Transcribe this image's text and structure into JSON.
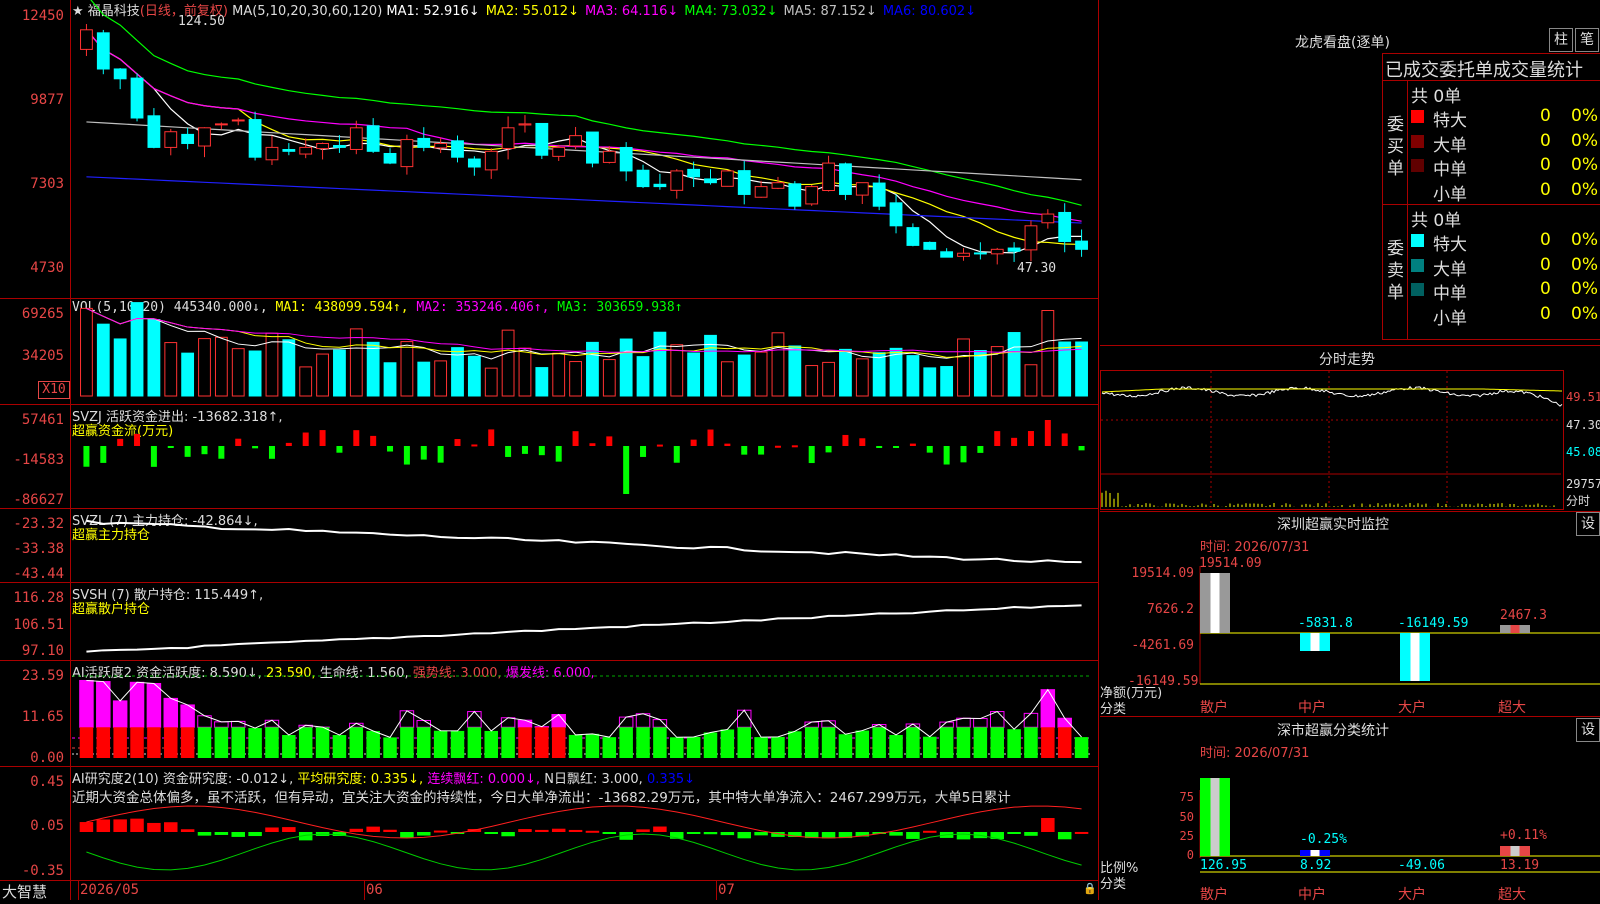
{
  "stock": {
    "name": "福晶科技",
    "period": "(日线，前复权)"
  },
  "ma_line": {
    "label": "MA(5,10,20,30,60,120)",
    "items": [
      {
        "name": "MA1",
        "value": "52.916",
        "arrow": "↓",
        "color": "#ffffff"
      },
      {
        "name": "MA2",
        "value": "55.012",
        "arrow": "↓",
        "color": "#ffff00"
      },
      {
        "name": "MA3",
        "value": "64.116",
        "arrow": "↓",
        "color": "#ff00ff"
      },
      {
        "name": "MA4",
        "value": "73.032",
        "arrow": "↓",
        "color": "#00ff00"
      },
      {
        "name": "MA5",
        "value": "87.152",
        "arrow": "↓",
        "color": "#c0c0c0"
      },
      {
        "name": "MA6",
        "value": "80.602",
        "arrow": "↓",
        "color": "#0000ff"
      }
    ]
  },
  "price_axis": [
    "12450",
    "9877",
    "7303",
    "4730"
  ],
  "price_marks": {
    "high": "124.50",
    "low": "47.30"
  },
  "vol": {
    "label": "VOL(5,10,20)",
    "value": "445340.000↓,",
    "ma1": "MA1: 438099.594↑,",
    "ma2": "MA2: 353246.406↑,",
    "ma3": "MA3: 303659.938↑",
    "axis": [
      "69265",
      "34205"
    ],
    "unit": "X10"
  },
  "svzj": {
    "label": "SVZJ  活跃资金进出: -13682.318↑,",
    "sub": "超赢资金流(万元)",
    "axis": [
      "57461",
      "-14583",
      "-86627"
    ]
  },
  "svzl": {
    "label": "SVZL (7) 主力持仓: -42.864↓,",
    "sub": "超赢主力持仓",
    "axis": [
      "-23.32",
      "-33.38",
      "-43.44"
    ]
  },
  "svsh": {
    "label": "SVSH (7) 散户持仓: 115.449↑,",
    "sub": "超赢散户持仓",
    "axis": [
      "116.28",
      "106.51",
      "97.10"
    ]
  },
  "ai1": {
    "label": "AI活跃度2 资金活跃度: 8.590↓,",
    "v2": "23.590,",
    "v3": "生命线: 1.560,",
    "v4": "强势线: 3.000,",
    "v5": "爆发线: 6.000,",
    "axis": [
      "23.59",
      "11.65",
      "0.00"
    ]
  },
  "ai2": {
    "label": "AI研究度2(10) 资金研究度: -0.012↓,",
    "v2": "平均研究度: 0.335↓,",
    "v3": "连续飘红: 0.000↓,",
    "v4": "N日飘红: 3.000,",
    "v5": "0.335↓",
    "axis": [
      "0.45",
      "0.05",
      "-0.35"
    ],
    "text": "近期大资金总体偏多，虽不活跃，但有异动，宜关注大资金的持续性，今日大单净流出：-13682.29万元，其中特大单净流入：2467.299万元，大单5日累计"
  },
  "bottom": {
    "brand": "大智慧",
    "dates": [
      "2026/05",
      "06",
      "07"
    ]
  },
  "lhb": {
    "title": "龙虎看盘(逐单)",
    "btn1": "柱",
    "btn2": "笔",
    "subtitle": "已成交委托单成交量统计",
    "buy": {
      "side": "委买单",
      "total": "共 0单",
      "rows": [
        {
          "label": "特大",
          "count": "0",
          "pct": "0%",
          "color": "#ff0000"
        },
        {
          "label": "大单",
          "count": "0",
          "pct": "0%",
          "color": "#800000"
        },
        {
          "label": "中单",
          "count": "0",
          "pct": "0%",
          "color": "#600000"
        },
        {
          "label": "小单",
          "count": "0",
          "pct": "0%",
          "color": "#000000"
        }
      ]
    },
    "sell": {
      "side": "委卖单",
      "total": "共 0单",
      "rows": [
        {
          "label": "特大",
          "count": "0",
          "pct": "0%",
          "color": "#00ffff"
        },
        {
          "label": "大单",
          "count": "0",
          "pct": "0%",
          "color": "#008080"
        },
        {
          "label": "中单",
          "count": "0",
          "pct": "0%",
          "color": "#006060"
        },
        {
          "label": "小单",
          "count": "0",
          "pct": "0%",
          "color": "#000000"
        }
      ]
    }
  },
  "fenshi": {
    "title": "分时走势",
    "axis": [
      "49.51",
      "47.30",
      "45.08"
    ],
    "vol": "29757",
    "vol_unit": "分时"
  },
  "sz_monitor": {
    "title": "深圳超赢实时监控",
    "btn": "设",
    "time": "时间: 2026/07/31",
    "axis": [
      "19514.09",
      "7626.2",
      "-4261.69",
      "-16149.59"
    ],
    "ylabel": "净额(万元)",
    "xlabel": "分类",
    "cats": [
      "散户",
      "中户",
      "大户",
      "超大"
    ],
    "values": [
      "19514.09",
      "-5831.8",
      "-16149.59",
      "2467.3"
    ]
  },
  "sz_stats": {
    "title": "深市超赢分类统计",
    "btn": "设",
    "time": "时间: 2026/07/31",
    "axis": [
      "75",
      "50",
      "25",
      "0"
    ],
    "ylabel": "比例%",
    "xlabel": "分类",
    "cats": [
      "散户",
      "中户",
      "大户",
      "超大"
    ],
    "values": [
      "126.95",
      "8.92",
      "-49.06",
      "13.19"
    ],
    "pcts": [
      "",
      "-0.25%",
      "",
      "+0.11%"
    ]
  }
}
